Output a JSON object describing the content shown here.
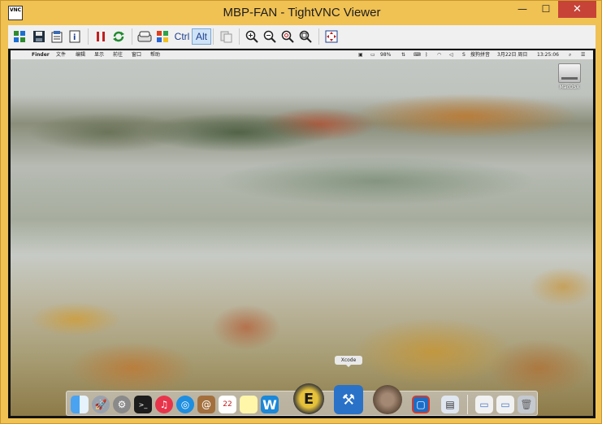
{
  "window": {
    "title": "MBP-FAN - TightVNC Viewer",
    "app_icon_text": "VNC",
    "minimize_glyph": "—",
    "maximize_glyph": "☐",
    "close_glyph": "✕"
  },
  "toolbar": {
    "ctrl_label": "Ctrl",
    "alt_label": "Alt"
  },
  "mac": {
    "menubar": {
      "apple": "",
      "items": [
        "Finder",
        "文件",
        "编辑",
        "显示",
        "前往",
        "窗口",
        "帮助"
      ],
      "battery": "98%",
      "input_method": "搜狗拼音",
      "date": "3月22日 周日",
      "time": "13:25:06"
    },
    "desktop": {
      "disk_label": "MacOSX"
    },
    "dock": {
      "tooltip": "Xcode"
    }
  },
  "colors": {
    "window_frame": "#f0c153",
    "close_button": "#c74337",
    "toolbar_bg": "#f0f0f0"
  }
}
